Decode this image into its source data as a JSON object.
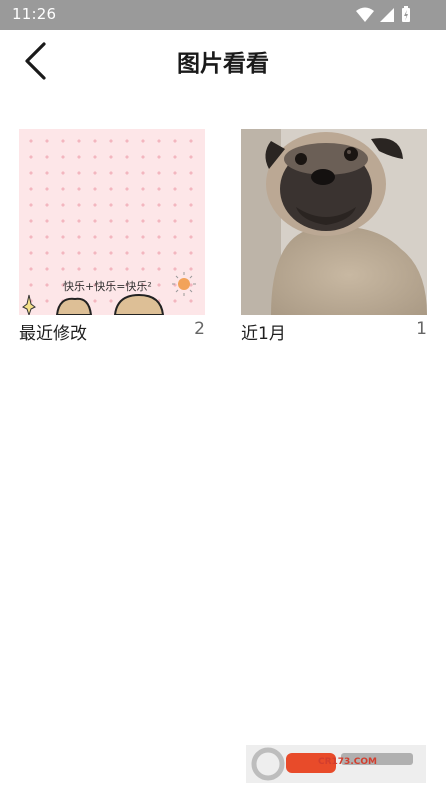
{
  "status_bar": {
    "time": "11:26"
  },
  "app_bar": {
    "title": "图片看看"
  },
  "albums": [
    {
      "name": "最近修改",
      "count": "2",
      "thumb_caption": "快乐+快乐=快乐²"
    },
    {
      "name": "近1月",
      "count": "1"
    }
  ],
  "watermark": {
    "text": "CR173.COM"
  },
  "colors": {
    "status_bar": "#9a9a9a",
    "accent_pink": "#fde6e8"
  }
}
